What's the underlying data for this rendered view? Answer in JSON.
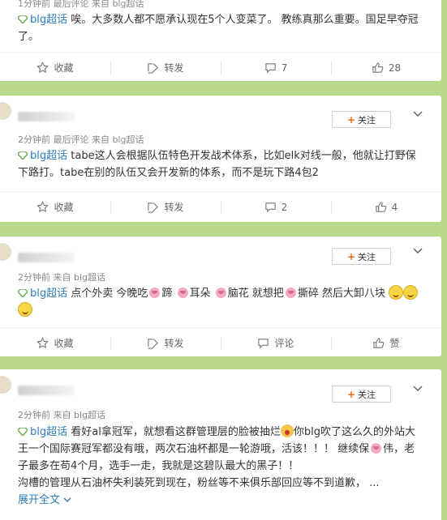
{
  "topic_label": "blg超话",
  "follow_label": "关注",
  "actions": {
    "fav": "收藏",
    "repost": "转发",
    "comment": "评论",
    "like": "赞"
  },
  "posts": [
    {
      "meta": "1分钟前 最后评论 来自 blg超话",
      "text": "唉。大多数人都不愿承认现在5个人变菜了。 教练真那么重要。国足早夺冠了。",
      "comments": "7",
      "likes": "28"
    },
    {
      "meta": "2分钟前 最后评论 来自 blg超话",
      "text": "tabe这人会根据队伍特色开发战术体系，比如elk对线一般，他就让打野保下路打。tabe在别的队伍又会开发新的体系，而不是玩下路4包2",
      "comments": "2",
      "likes": "4"
    },
    {
      "meta": "2分钟前 来自 blg超话",
      "text_parts": [
        "点个外卖 今晚吃",
        "蹄",
        "耳朵",
        "脑花 就想把",
        "撕碎 然后大卸八块"
      ],
      "comments": "评论",
      "likes": "赞"
    },
    {
      "meta": "2分钟前 来自 blg超话",
      "text_a": "看好al拿冠军，就想看这群管理层的脸被抽烂",
      "text_b": "你blg吹了这么久的外站大王一个国际赛冠军都没有哦，两次石油杯都是一轮游哦，活该！！！ 继续保",
      "text_c": "伟，老子最多在苟4个月，选手一走，我就是这碧队最大的黑子！！",
      "text_d": "沟槽的管理从石油杯失利装死到现在，粉丝等不来俱乐部回应等不到道歉，  ...",
      "expand": "展开全文"
    }
  ],
  "colors": {
    "bg": "#b9d98a",
    "topic": "#2e7db8",
    "follow_plus": "#e86a1a"
  },
  "icons": [
    "star-icon",
    "repost-icon",
    "comment-icon",
    "thumbs-up-icon",
    "chevron-down-icon",
    "diamond-icon",
    "pig-emoji-icon",
    "smile-emoji-icon"
  ]
}
